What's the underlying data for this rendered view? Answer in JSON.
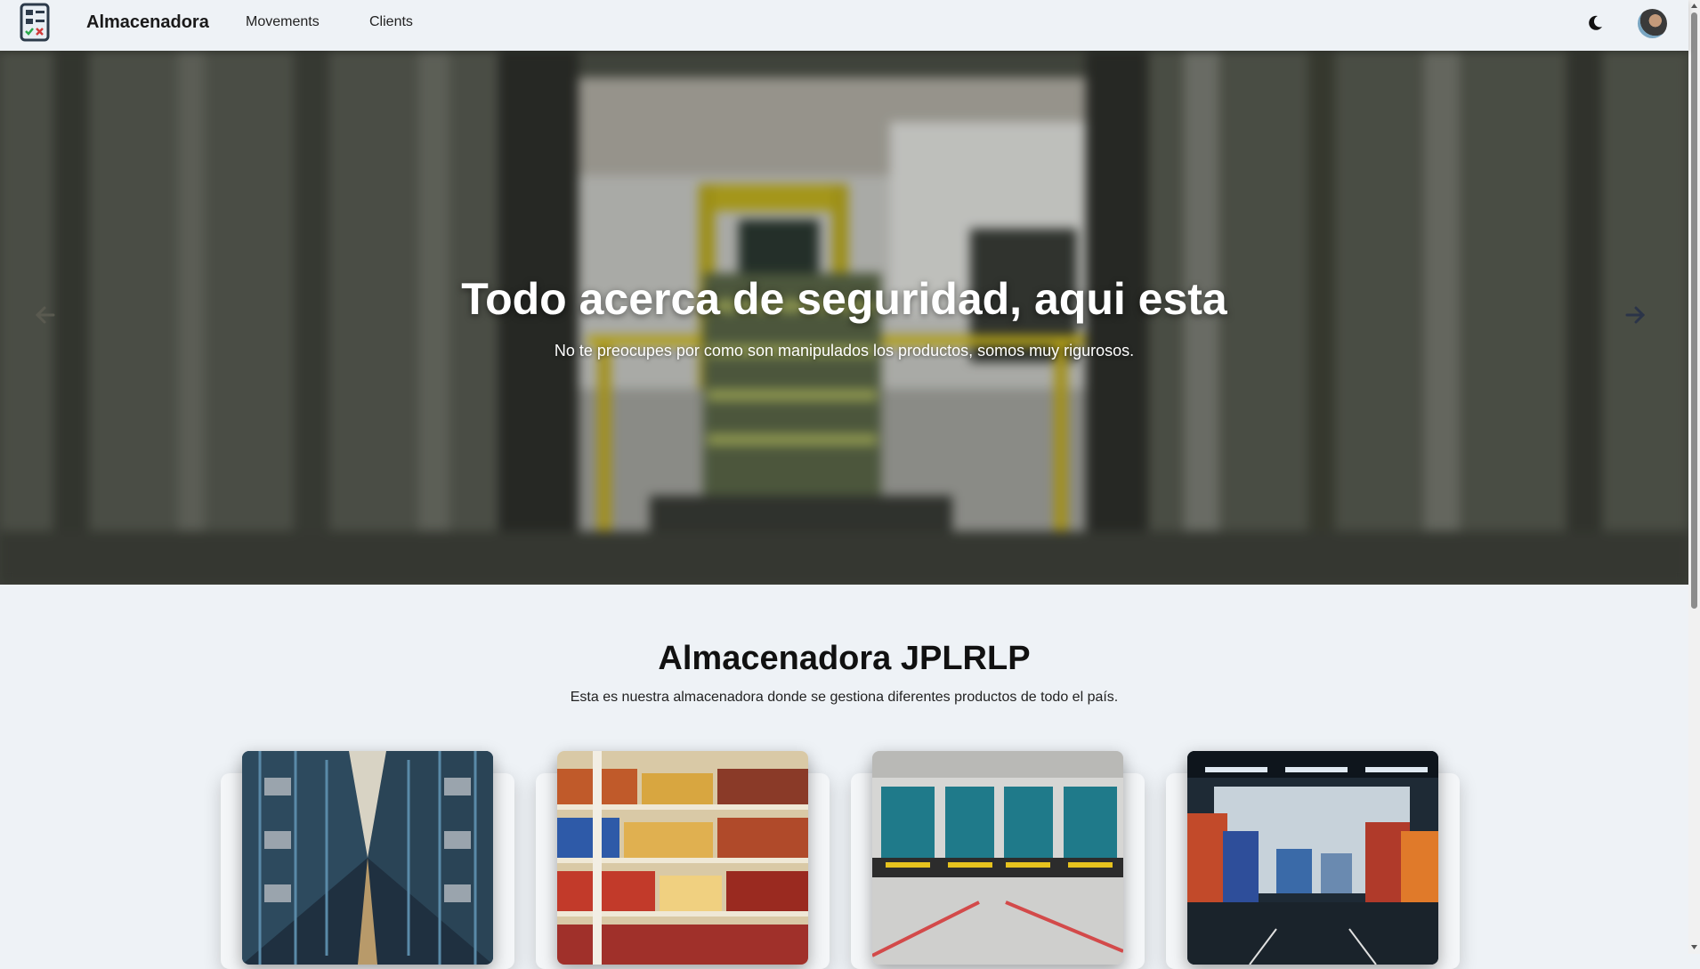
{
  "nav": {
    "brand": "Almacenadora",
    "links": [
      "Movements",
      "Clients"
    ]
  },
  "hero": {
    "title": "Todo acerca de seguridad, aqui esta",
    "subtitle": "No te preocupes por como son manipulados los productos, somos muy rigurosos."
  },
  "section": {
    "title": "Almacenadora JPLRLP",
    "subtitle": "Esta es nuestra almacenadora donde se gestiona diferentes productos de todo el país."
  },
  "icons": {
    "logo": "calculator-icon",
    "theme": "moon-icon",
    "prev": "arrow-left-icon",
    "next": "arrow-right-icon"
  },
  "colors": {
    "background": "#eef2f6",
    "accent_yellow": "#d8c21c"
  }
}
